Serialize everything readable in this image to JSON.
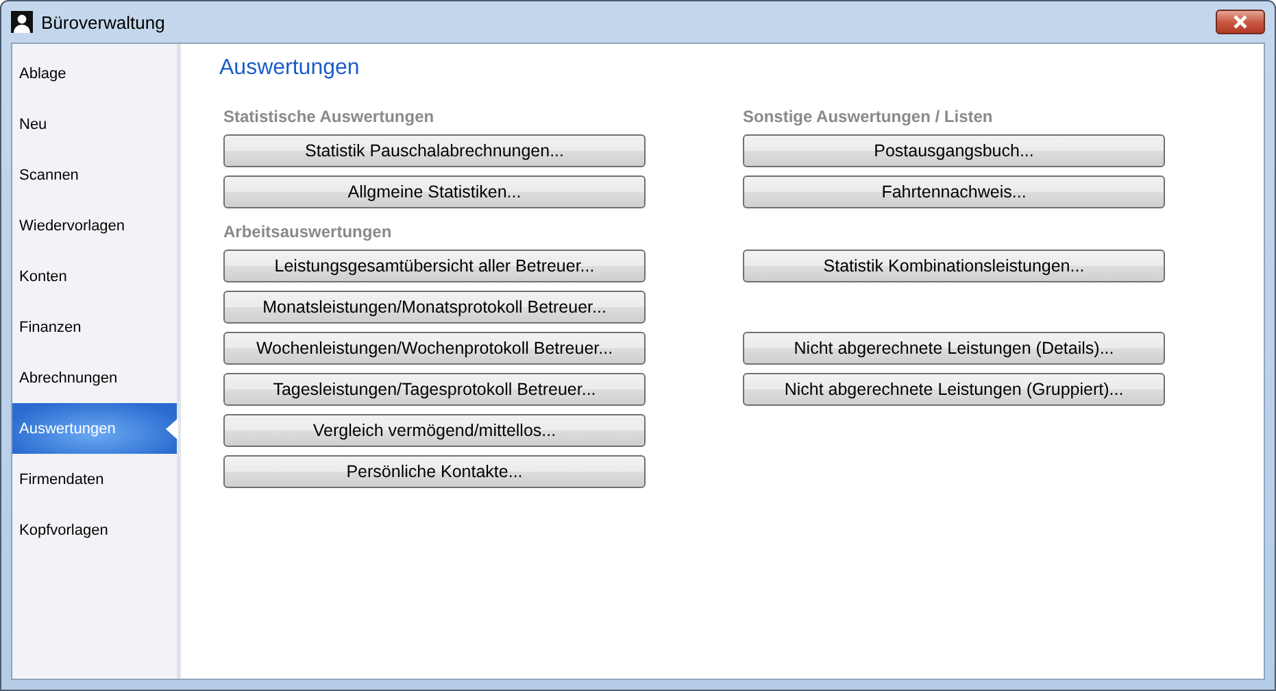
{
  "window": {
    "title": "Büroverwaltung"
  },
  "sidebar": {
    "items": [
      {
        "label": "Ablage",
        "selected": false
      },
      {
        "label": "Neu",
        "selected": false
      },
      {
        "label": "Scannen",
        "selected": false
      },
      {
        "label": "Wiedervorlagen",
        "selected": false
      },
      {
        "label": "Konten",
        "selected": false
      },
      {
        "label": "Finanzen",
        "selected": false
      },
      {
        "label": "Abrechnungen",
        "selected": false
      },
      {
        "label": "Auswertungen",
        "selected": true
      },
      {
        "label": "Firmendaten",
        "selected": false
      },
      {
        "label": "Kopfvorlagen",
        "selected": false
      }
    ]
  },
  "page": {
    "title": "Auswertungen",
    "rows": [
      {
        "left": {
          "kind": "heading",
          "label": "Statistische Auswertungen"
        },
        "right": {
          "kind": "heading",
          "label": "Sonstige Auswertungen / Listen"
        }
      },
      {
        "left": {
          "kind": "button",
          "label": "Statistik Pauschalabrechnungen..."
        },
        "right": {
          "kind": "button",
          "label": "Postausgangsbuch..."
        }
      },
      {
        "left": {
          "kind": "button",
          "label": "Allgmeine Statistiken..."
        },
        "right": {
          "kind": "button",
          "label": "Fahrtennachweis..."
        }
      },
      {
        "left": {
          "kind": "heading",
          "label": "Arbeitsauswertungen"
        }
      },
      {
        "left": {
          "kind": "button",
          "label": "Leistungsgesamtübersicht aller Betreuer..."
        },
        "right": {
          "kind": "button",
          "label": "Statistik Kombinationsleistungen..."
        }
      },
      {
        "left": {
          "kind": "button",
          "label": "Monatsleistungen/Monatsprotokoll Betreuer..."
        }
      },
      {
        "left": {
          "kind": "button",
          "label": "Wochenleistungen/Wochenprotokoll Betreuer..."
        },
        "right": {
          "kind": "button",
          "label": "Nicht abgerechnete Leistungen (Details)..."
        }
      },
      {
        "left": {
          "kind": "button",
          "label": "Tagesleistungen/Tagesprotokoll Betreuer..."
        },
        "right": {
          "kind": "button",
          "label": "Nicht abgerechnete Leistungen (Gruppiert)..."
        }
      },
      {
        "left": {
          "kind": "button",
          "label": "Vergleich vermögend/mittellos..."
        }
      },
      {
        "left": {
          "kind": "button",
          "label": "Persönliche Kontakte..."
        }
      }
    ]
  }
}
